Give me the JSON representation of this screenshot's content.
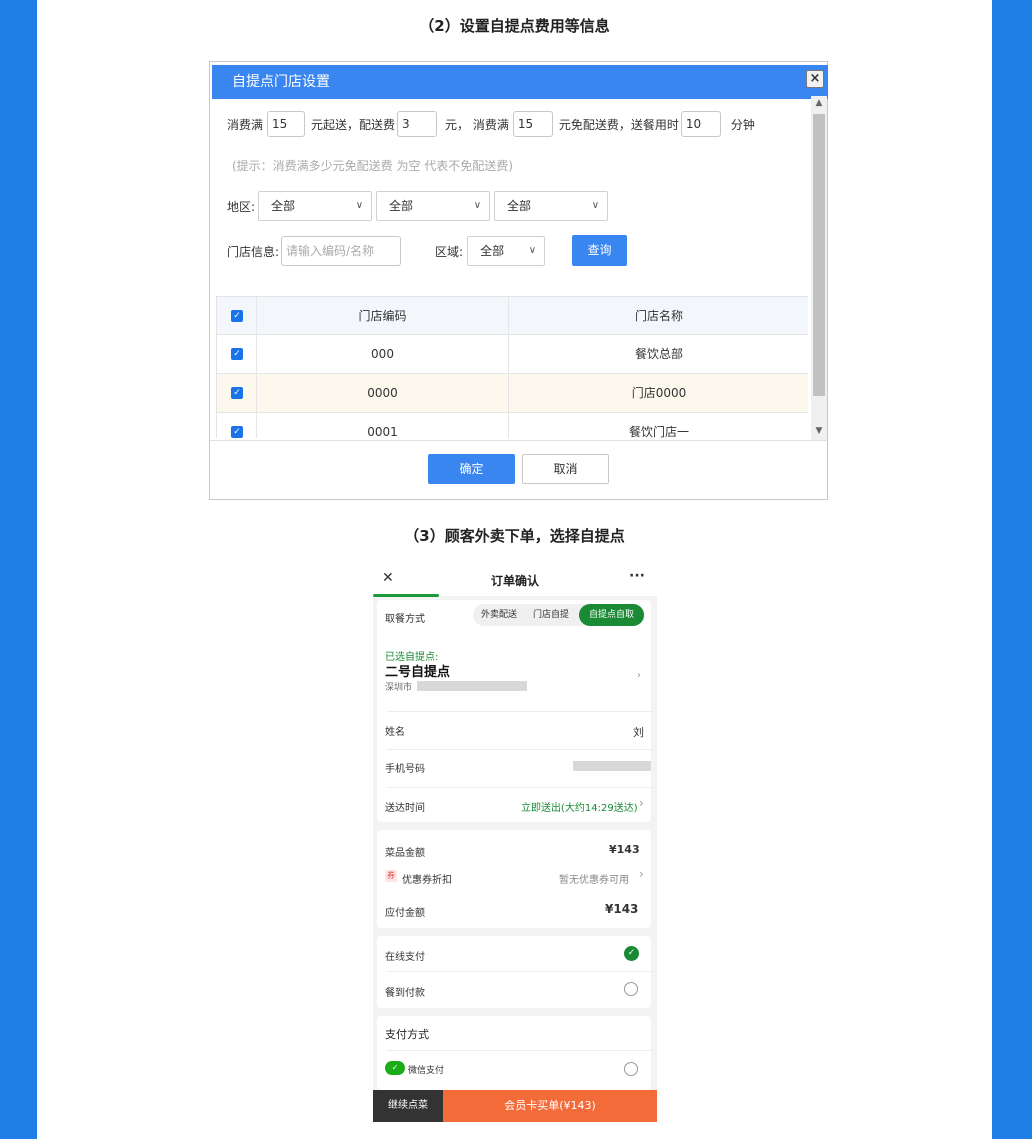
{
  "section2_title": "（2）设置自提点费用等信息",
  "section3_title": "（3）顾客外卖下单，选择自提点",
  "dialog": {
    "title": "自提点门店设置",
    "close_glyph": "×",
    "fee_row": {
      "label_min_spend": "消费满",
      "min_spend_value": "15",
      "label_delivery_fee": "元起送，配送费",
      "delivery_fee_value": "3",
      "label_free_delivery": "元，  消费满",
      "free_delivery_value": "15",
      "label_delivery_time": "元免配送费，送餐用时",
      "delivery_time_value": "10",
      "label_minutes": "分钟"
    },
    "hint": "(提示：消费满多少元免配送费 为空 代表不免配送费)",
    "region_label": "地区:",
    "region_selects": [
      "全部",
      "全部",
      "全部"
    ],
    "store_info_label": "门店信息:",
    "store_info_placeholder": "请输入编码/名称",
    "area_label": "区域:",
    "area_select": "全部",
    "query_button": "查询",
    "table": {
      "headers": [
        "门店编码",
        "门店名称"
      ],
      "rows": [
        {
          "code": "000",
          "name": "餐饮总部"
        },
        {
          "code": "0000",
          "name": "门店0000"
        },
        {
          "code": "0001",
          "name": "餐饮门店一"
        }
      ]
    },
    "confirm_button": "确定",
    "cancel_button": "取消"
  },
  "phone": {
    "title": "订单确认",
    "close_glyph": "✕",
    "more_glyph": "···",
    "pickup_label": "取餐方式",
    "pickup_options": [
      "外卖配送",
      "门店自提",
      "自提点自取"
    ],
    "selected_point_label": "已选自提点:",
    "selected_point_name": "二号自提点",
    "selected_point_addr": "深圳市",
    "name_label": "姓名",
    "name_value": "刘",
    "phone_label": "手机号码",
    "delivery_time_label": "送达时间",
    "delivery_time_value": "立即送出(大约14:29送达)",
    "dish_amount_label": "菜品金额",
    "dish_amount_value": "¥143",
    "coupon_badge": "券",
    "coupon_label": "优惠券折扣",
    "coupon_value": "暂无优惠券可用",
    "payable_label": "应付金额",
    "payable_value": "¥143",
    "online_pay_label": "在线支付",
    "cod_label": "餐到付款",
    "pay_method_title": "支付方式",
    "wechat_pay_label": "微信支付",
    "continue_button": "继续点菜",
    "member_pay_button": "会员卡买单(¥143)",
    "accent_green": "#1a8a34",
    "accent_orange": "#f46b3a"
  }
}
